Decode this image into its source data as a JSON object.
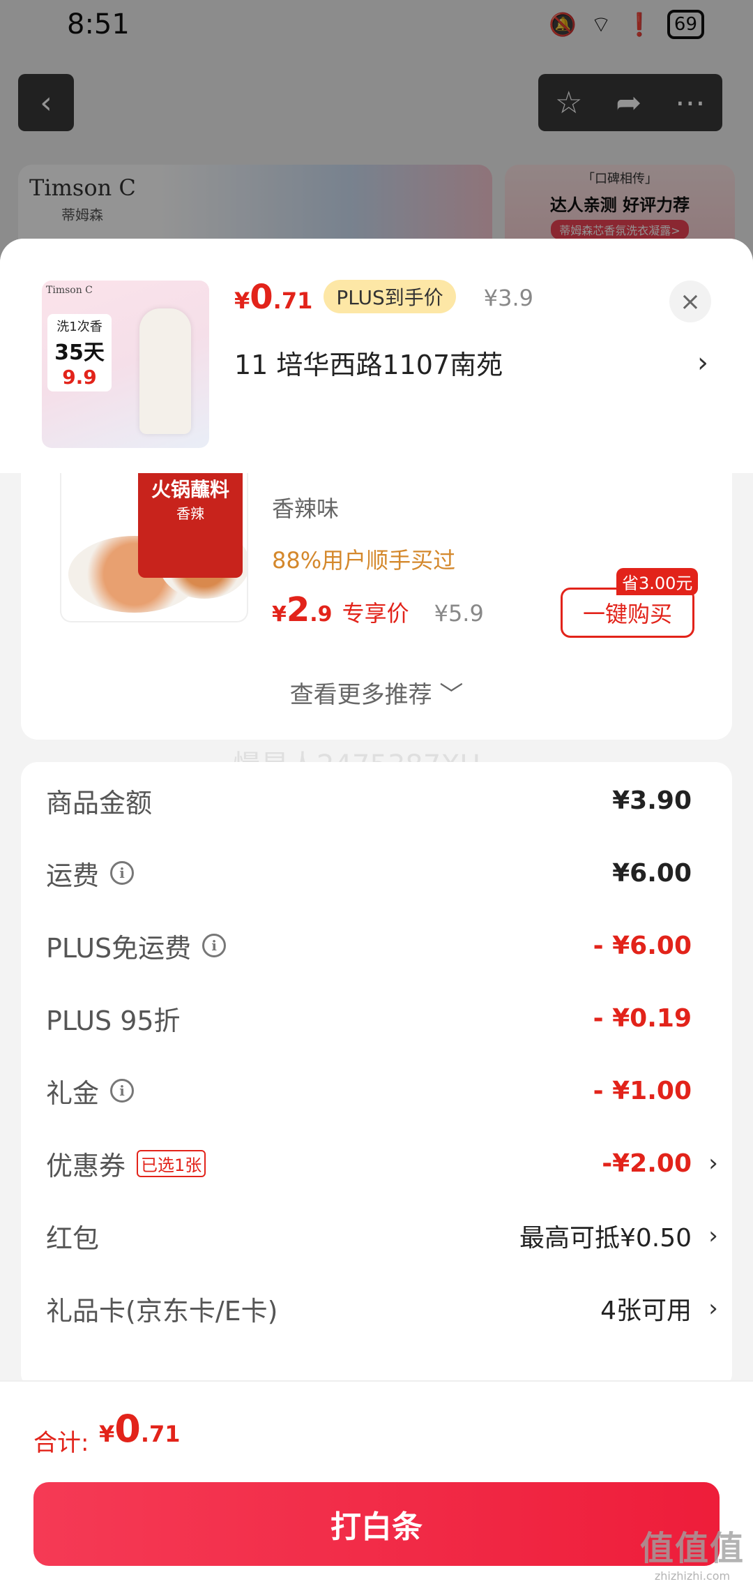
{
  "status_bar": {
    "time": "8:51",
    "battery": "69"
  },
  "background": {
    "brand": "Timson C",
    "brand_cn": "蒂姆森",
    "banner2_line1": "「口碑相传」",
    "banner2_line2": "达人亲测  好评力荐",
    "banner2_line3": "蒂姆森芯香氛洗衣凝露>"
  },
  "product": {
    "image_brand": "Timson C",
    "image_line1": "洗1次香",
    "image_line2": "35天",
    "image_price": "9.9",
    "price_symbol": "¥",
    "price_int": "0",
    "price_dec": ".71",
    "plus_badge": "PLUS到手价",
    "original_price": "¥3.9",
    "close": "×",
    "address": "11  培华西路1107南苑",
    "address_arrow": "›"
  },
  "recommend": {
    "pack_title": "火锅蘸料",
    "pack_sub": "香辣",
    "flavor": "香辣味",
    "bought": "88%用户顺手买过",
    "price_symbol": "¥",
    "price_int": "2",
    "price_dec": ".9",
    "price_label": "专享价",
    "original_price": "¥5.9",
    "save_tag": "省3.00元",
    "buy_button": "一键购买",
    "more": "查看更多推荐 ﹀"
  },
  "watermark": "慢星人2475387XU",
  "costs": {
    "goods": {
      "label": "商品金额",
      "value": "¥3.90"
    },
    "shipping": {
      "label": "运费",
      "value": "¥6.00"
    },
    "plus_free_shipping": {
      "label": "PLUS免运费",
      "value": "- ¥6.00"
    },
    "plus_discount": {
      "label": "PLUS 95折",
      "value": "- ¥0.19"
    },
    "gift_money": {
      "label": "礼金",
      "value": "- ¥1.00"
    },
    "coupon": {
      "label": "优惠券",
      "tag": "已选1张",
      "value": "-¥2.00"
    },
    "red_packet": {
      "label": "红包",
      "value": "最高可抵¥0.50"
    },
    "gift_card": {
      "label": "礼品卡(京东卡/E卡)",
      "value": "4张可用"
    },
    "info_glyph": "i",
    "chevron": "›"
  },
  "total": {
    "label": "合计:",
    "symbol": "¥",
    "int": "0",
    "dec": ".71"
  },
  "pay_button": "打白条",
  "corner_watermark": {
    "big": "值值值",
    "small": "zhizhizhi.com"
  },
  "colors": {
    "accent": "#e2231a",
    "pay_button": "#f53a55",
    "bought_text": "#d4882c",
    "plus_badge_bg": "#fde7a6"
  }
}
